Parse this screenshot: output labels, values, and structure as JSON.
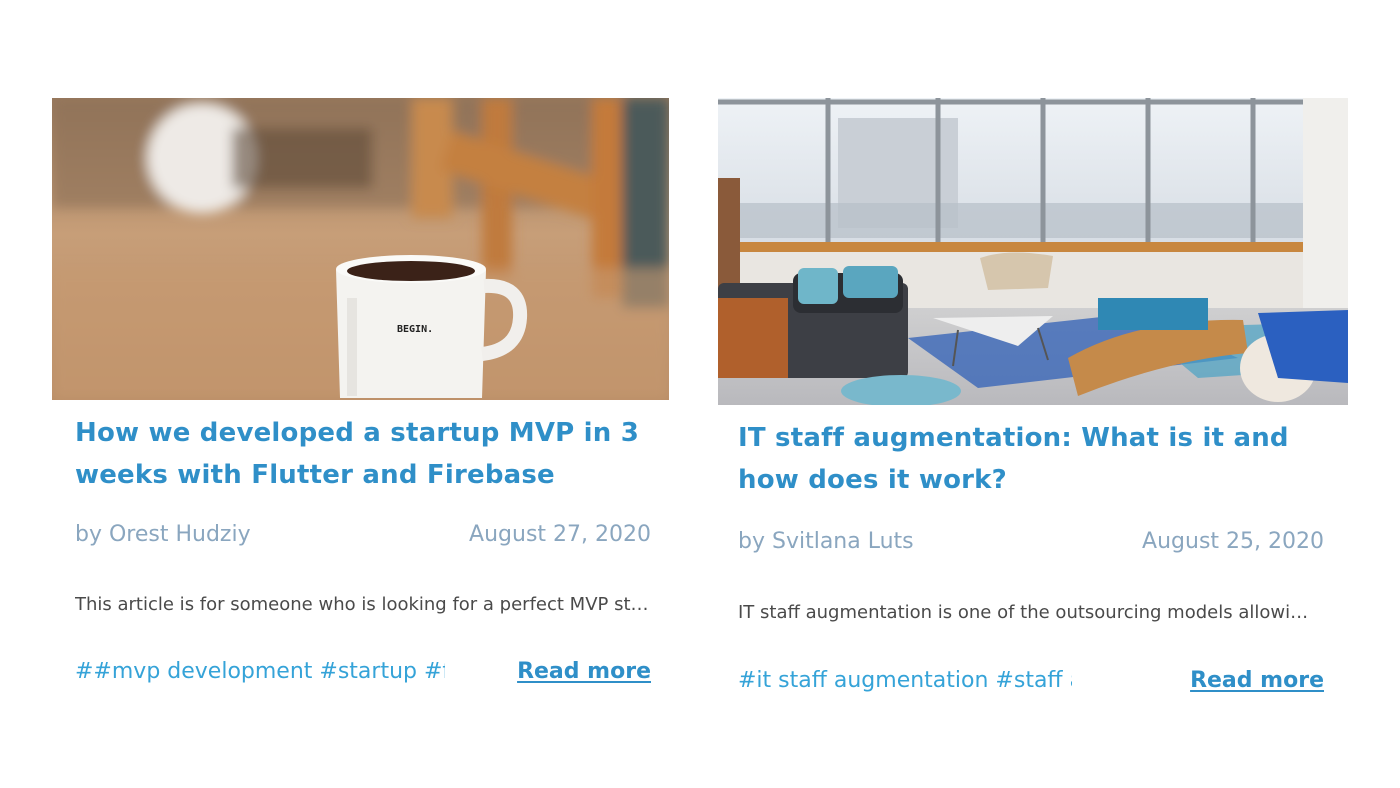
{
  "posts": [
    {
      "title": "How we developed a startup MVP in 3 weeks with Flutter and Firebase",
      "author": "by Orest Hudziy",
      "date": "August 27, 2020",
      "excerpt": "This article is for someone who is looking for a perfect MVP stac…",
      "tags": "##mvp development #startup #flu",
      "read_more": "Read more",
      "image_mug_text": "BEGIN."
    },
    {
      "title": "IT staff augmentation: What is it and how does it work?",
      "author": "by Svitlana Luts",
      "date": "August 25, 2020",
      "excerpt": "IT staff augmentation is one of the outsourcing models allowin…",
      "tags": "#it staff augmentation #staff a",
      "read_more": "Read more"
    }
  ],
  "colors": {
    "title": "#2f8fc8",
    "meta": "#8aa6bf",
    "tags": "#35a3d8",
    "excerpt": "#4a4a4a"
  }
}
